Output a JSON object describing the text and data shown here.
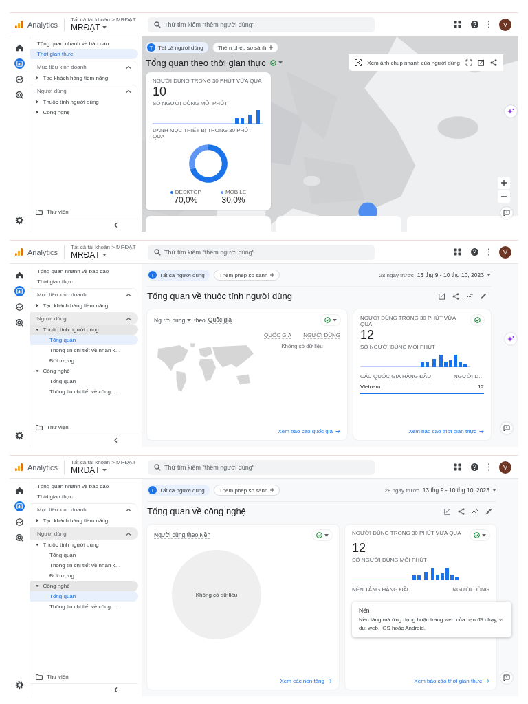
{
  "screens": [
    {
      "kind": "realtime",
      "header": {
        "product": "Analytics",
        "breadcrumb": "Tất cả tài khoản > MRĐẠT",
        "property": "MRĐẠT",
        "search_placeholder": "Thử tìm kiếm \"thêm người dùng\"",
        "avatar": "V"
      },
      "rail": [
        {
          "kind": "home",
          "selected": false
        },
        {
          "kind": "reports",
          "selected": true
        },
        {
          "kind": "explore",
          "selected": false
        },
        {
          "kind": "advertising",
          "selected": false
        }
      ],
      "sidebar": [
        {
          "kind": "link",
          "label": "Tổng quan nhanh về báo cáo",
          "selected": false
        },
        {
          "kind": "link",
          "label": "Thời gian thực",
          "selected": true
        },
        {
          "kind": "section",
          "label": "Mục tiêu kinh doanh",
          "expanded": true,
          "highlighted": false,
          "children": [
            {
              "kind": "group",
              "label": "Tạo khách hàng tiềm năng",
              "expanded": false,
              "highlighted": false
            }
          ]
        },
        {
          "kind": "section",
          "label": "Người dùng",
          "expanded": true,
          "highlighted": false,
          "children": [
            {
              "kind": "group",
              "label": "Thuộc tính người dùng",
              "expanded": false,
              "highlighted": false
            },
            {
              "kind": "group",
              "label": "Công nghệ",
              "expanded": false,
              "highlighted": false
            }
          ]
        },
        {
          "kind": "library",
          "label": "Thư viện"
        }
      ],
      "chips": [
        {
          "kind": "segment",
          "badge": "T",
          "label": "Tất cả người dùng"
        },
        {
          "kind": "add",
          "label": "Thêm phép so sánh"
        }
      ],
      "title": "Tổng quan theo thời gian thực",
      "title_status": {
        "dropdown": true
      },
      "toolbar": {
        "label": "Xem ảnh chụp nhanh của người dùng"
      },
      "cards": [
        {
          "kind": "realtime_devices",
          "title": "NGƯỜI DÙNG TRONG 30 PHÚT VỪA QUA",
          "value": "10",
          "subtitle": "SỐ NGƯỜI DÙNG MỖI PHÚT",
          "device_title": "DANH MỤC THIẾT BỊ TRONG 30 PHÚT QUA",
          "chart_data": {
            "type": "donut",
            "categories": [
              "DESKTOP",
              "MOBILE"
            ],
            "values": [
              70,
              30
            ],
            "value_labels": [
              "70,0%",
              "30,0%"
            ],
            "legend": "bottom"
          }
        }
      ],
      "floating": [
        {
          "kind": "assistant"
        },
        {
          "kind": "zoom_in"
        },
        {
          "kind": "zoom_out"
        },
        {
          "kind": "feedback"
        }
      ]
    },
    {
      "kind": "overview",
      "header": {
        "product": "Analytics",
        "breadcrumb": "Tất cả tài khoản > MRĐẠT",
        "property": "MRĐẠT",
        "search_placeholder": "Thử tìm kiếm \"thêm người dùng\"",
        "avatar": "V"
      },
      "rail": [
        {
          "kind": "home",
          "selected": false
        },
        {
          "kind": "reports",
          "selected": true
        },
        {
          "kind": "explore",
          "selected": false
        },
        {
          "kind": "advertising",
          "selected": false
        }
      ],
      "sidebar": [
        {
          "kind": "link",
          "label": "Tổng quan nhanh về báo cáo",
          "selected": false
        },
        {
          "kind": "link",
          "label": "Thời gian thực",
          "selected": false
        },
        {
          "kind": "section",
          "label": "Mục tiêu kinh doanh",
          "expanded": true,
          "highlighted": false,
          "children": [
            {
              "kind": "group",
              "label": "Tạo khách hàng tiềm năng",
              "expanded": false,
              "highlighted": false
            }
          ]
        },
        {
          "kind": "section",
          "label": "Người dùng",
          "expanded": true,
          "highlighted": true,
          "children": [
            {
              "kind": "group",
              "label": "Thuộc tính người dùng",
              "expanded": true,
              "highlighted": true,
              "children": [
                {
                  "kind": "link",
                  "label": "Tổng quan",
                  "selected": true
                },
                {
                  "kind": "link",
                  "label": "Thông tin chi tiết về nhân k…",
                  "selected": false
                },
                {
                  "kind": "link",
                  "label": "Đối tượng",
                  "selected": false
                }
              ]
            },
            {
              "kind": "group",
              "label": "Công nghệ",
              "expanded": true,
              "highlighted": false,
              "children": [
                {
                  "kind": "link",
                  "label": "Tổng quan",
                  "selected": false
                },
                {
                  "kind": "link",
                  "label": "Thông tin chi tiết về công …",
                  "selected": false
                }
              ]
            }
          ]
        },
        {
          "kind": "library",
          "label": "Thư viện"
        }
      ],
      "chips": [
        {
          "kind": "segment",
          "badge": "T",
          "label": "Tất cả người dùng"
        },
        {
          "kind": "add",
          "label": "Thêm phép so sánh"
        }
      ],
      "date_range": {
        "label": "28 ngày trước",
        "value": "13 thg 9 - 10 thg 10, 2023"
      },
      "title": "Tổng quan về thuộc tính người dùng",
      "cards": [
        {
          "kind": "country_map",
          "metric": "Người dùng",
          "dimension_prefix": "theo",
          "dimension": "Quốc gia",
          "status": {
            "dropdown": true
          },
          "columns": [
            "QUỐC GIA",
            "NGƯỜI DÙNG"
          ],
          "empty": "Không có dữ liệu",
          "link": "Xem báo cáo quốc gia"
        },
        {
          "kind": "realtime",
          "title": "NGƯỜI DÙNG TRONG 30 PHÚT VỪA QUA",
          "status": {
            "dropdown": false
          },
          "value": "12",
          "subtitle": "SỐ NGƯỜI DÙNG MỖI PHÚT",
          "columns": [
            "CÁC QUỐC GIA HÀNG ĐẦU",
            "NGƯỜI D…"
          ],
          "rows": [
            {
              "label": "Vietnam",
              "value": "12",
              "level": 1
            }
          ],
          "link": "Xem báo cáo thời gian thực"
        }
      ],
      "floating": [
        {
          "kind": "assistant"
        },
        {
          "kind": "feedback"
        }
      ]
    },
    {
      "kind": "overview",
      "header": {
        "product": "Analytics",
        "breadcrumb": "Tất cả tài khoản > MRĐẠT",
        "property": "MRĐẠT",
        "search_placeholder": "Thử tìm kiếm \"thêm người dùng\"",
        "avatar": "V"
      },
      "rail": [
        {
          "kind": "home",
          "selected": false
        },
        {
          "kind": "reports",
          "selected": true
        },
        {
          "kind": "explore",
          "selected": false
        },
        {
          "kind": "advertising",
          "selected": false
        }
      ],
      "sidebar": [
        {
          "kind": "link",
          "label": "Tổng quan nhanh về báo cáo",
          "selected": false
        },
        {
          "kind": "link",
          "label": "Thời gian thực",
          "selected": false
        },
        {
          "kind": "section",
          "label": "Mục tiêu kinh doanh",
          "expanded": true,
          "highlighted": false,
          "children": [
            {
              "kind": "group",
              "label": "Tạo khách hàng tiềm năng",
              "expanded": false,
              "highlighted": false
            }
          ]
        },
        {
          "kind": "section",
          "label": "Người dùng",
          "expanded": true,
          "highlighted": true,
          "children": [
            {
              "kind": "group",
              "label": "Thuộc tính người dùng",
              "expanded": true,
              "highlighted": false,
              "children": [
                {
                  "kind": "link",
                  "label": "Tổng quan",
                  "selected": false
                },
                {
                  "kind": "link",
                  "label": "Thông tin chi tiết về nhân k…",
                  "selected": false
                },
                {
                  "kind": "link",
                  "label": "Đối tượng",
                  "selected": false
                }
              ]
            },
            {
              "kind": "group",
              "label": "Công nghệ",
              "expanded": true,
              "highlighted": true,
              "children": [
                {
                  "kind": "link",
                  "label": "Tổng quan",
                  "selected": true
                },
                {
                  "kind": "link",
                  "label": "Thông tin chi tiết về công …",
                  "selected": false
                }
              ]
            }
          ]
        },
        {
          "kind": "library",
          "label": "Thư viện"
        }
      ],
      "chips": [
        {
          "kind": "segment",
          "badge": "T",
          "label": "Tất cả người dùng"
        },
        {
          "kind": "add",
          "label": "Thêm phép so sánh"
        }
      ],
      "date_range": {
        "label": "28 ngày trước",
        "value": "13 thg 9 - 10 thg 10, 2023"
      },
      "title": "Tổng quan về công nghệ",
      "cards": [
        {
          "kind": "platform_pie",
          "title": "Người dùng theo Nền",
          "status": {
            "dropdown": true
          },
          "empty": "Không có dữ liệu",
          "link": "Xem các nền tảng"
        },
        {
          "kind": "realtime",
          "title": "NGƯỜI DÙNG TRONG 30 PHÚT VỪA QUA",
          "status": {
            "dropdown": true
          },
          "value": "12",
          "subtitle": "SỐ NGƯỜI DÙNG MỖI PHÚT",
          "columns": [
            "NỀN TẢNG HÀNG ĐẦU",
            "NGƯỜI DÙNG"
          ],
          "tooltip": {
            "title": "Nền",
            "text": "Nền tảng mà ứng dụng hoặc trang web của bạn đã chạy, ví dụ: web, iOS hoặc Android."
          },
          "link": "Xem báo cáo thời gian thực"
        }
      ],
      "floating": [
        {
          "kind": "feedback"
        }
      ]
    }
  ]
}
